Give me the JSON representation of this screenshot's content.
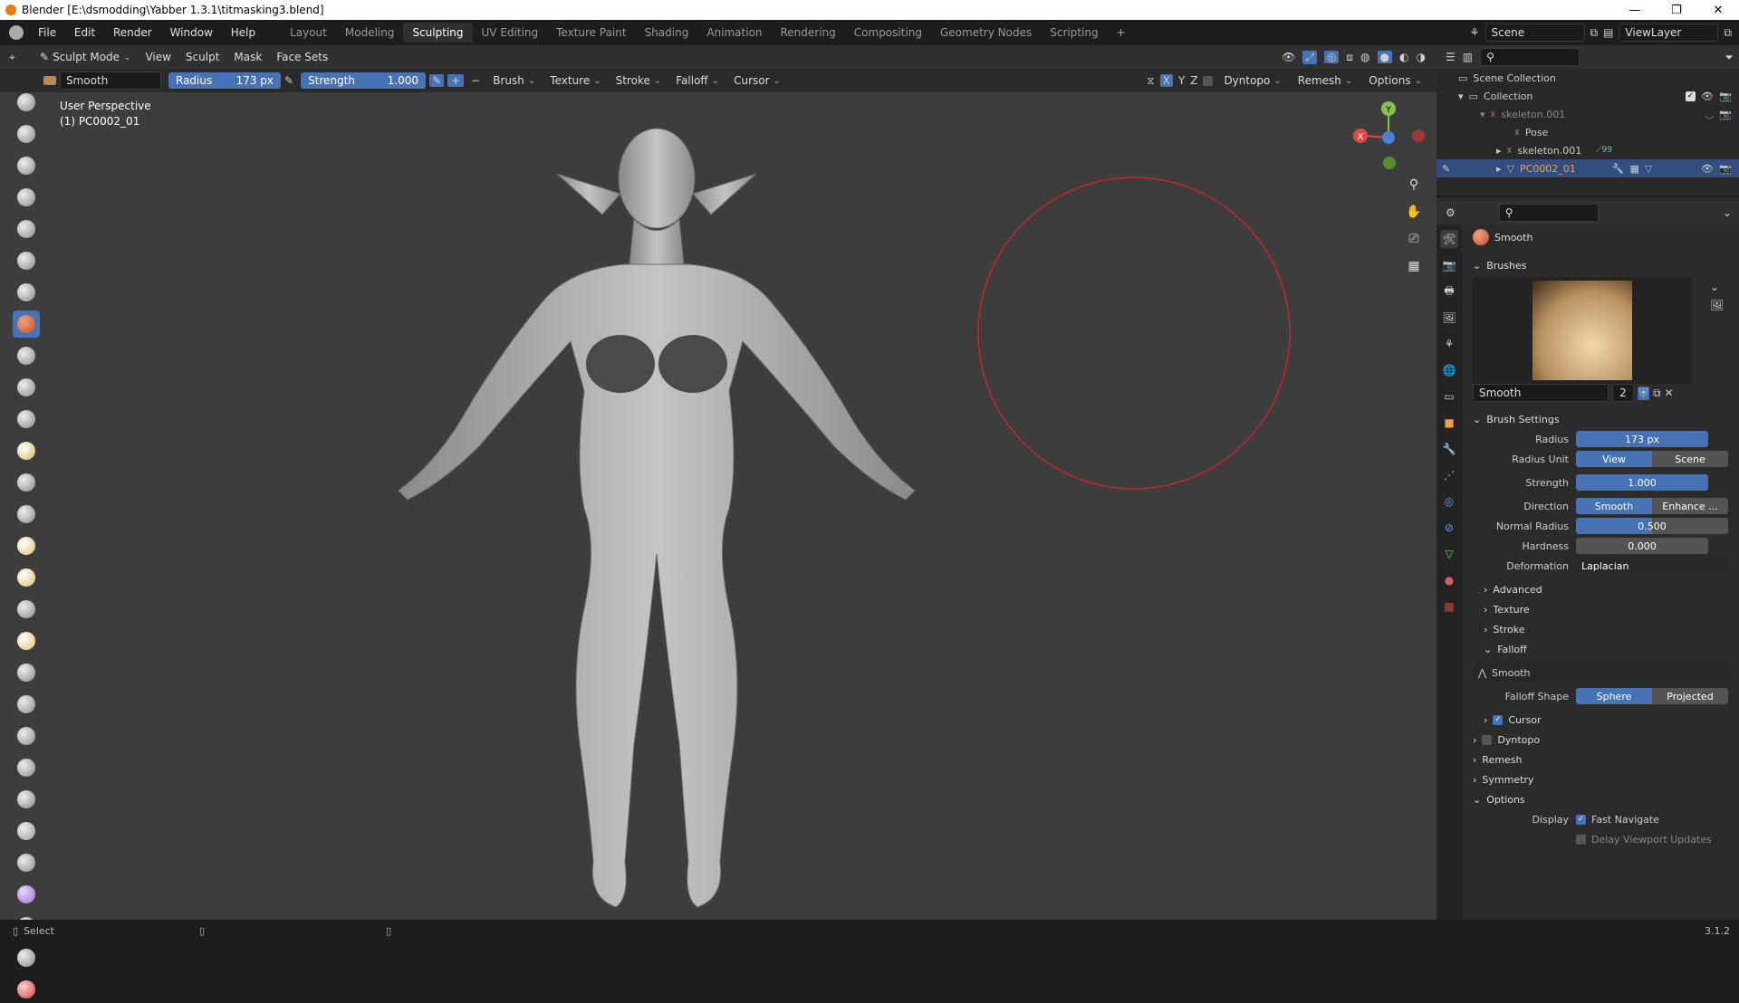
{
  "window": {
    "title": "Blender [E:\\dsmodding\\Yabber 1.3.1\\titmasking3.blend]"
  },
  "menu": [
    "File",
    "Edit",
    "Render",
    "Window",
    "Help"
  ],
  "workspaces": [
    "Layout",
    "Modeling",
    "Sculpting",
    "UV Editing",
    "Texture Paint",
    "Shading",
    "Animation",
    "Rendering",
    "Compositing",
    "Geometry Nodes",
    "Scripting"
  ],
  "active_workspace": "Sculpting",
  "scene": {
    "name": "Scene",
    "view_layer": "ViewLayer"
  },
  "viewport_header": {
    "mode": "Sculpt Mode",
    "menus": [
      "View",
      "Sculpt",
      "Mask",
      "Face Sets"
    ]
  },
  "tool_header": {
    "brush_name": "Smooth",
    "radius_label": "Radius",
    "radius_value": "173 px",
    "strength_label": "Strength",
    "strength_value": "1.000",
    "dropdowns": [
      "Brush",
      "Texture",
      "Stroke",
      "Falloff",
      "Cursor"
    ],
    "axes": [
      "X",
      "Y",
      "Z"
    ],
    "dyntopo": "Dyntopo",
    "remesh": "Remesh",
    "options": "Options"
  },
  "viewport_overlay": {
    "perspective": "User Perspective",
    "object": "(1) PC0002_01"
  },
  "gizmo": {
    "y": "Y",
    "x": "X"
  },
  "outliner": {
    "items": [
      {
        "label": "Scene Collection"
      },
      {
        "label": "Collection"
      },
      {
        "label": "skeleton.001"
      },
      {
        "label": "Pose"
      },
      {
        "label": "skeleton.001",
        "badge": "99"
      },
      {
        "label": "PC0002_01"
      }
    ]
  },
  "properties": {
    "brush_name": "Smooth",
    "brushes_title": "Brushes",
    "brush_slot": "Smooth",
    "brush_users": "2",
    "brush_settings_title": "Brush Settings",
    "radius": {
      "label": "Radius",
      "value": "173 px"
    },
    "radius_unit": {
      "label": "Radius Unit",
      "options": [
        "View",
        "Scene"
      ]
    },
    "strength": {
      "label": "Strength",
      "value": "1.000"
    },
    "direction": {
      "label": "Direction",
      "options": [
        "Smooth",
        "Enhance ..."
      ]
    },
    "normal_radius": {
      "label": "Normal Radius",
      "value": "0.500"
    },
    "hardness": {
      "label": "Hardness",
      "value": "0.000"
    },
    "deformation": {
      "label": "Deformation",
      "value": "Laplacian"
    },
    "subpanels": [
      "Advanced",
      "Texture",
      "Stroke",
      "Falloff"
    ],
    "falloff_preset": "Smooth",
    "falloff_shape": {
      "label": "Falloff Shape",
      "options": [
        "Sphere",
        "Projected"
      ]
    },
    "cursor": "Cursor",
    "dyntopo": "Dyntopo",
    "remesh": "Remesh",
    "symmetry": "Symmetry",
    "options_title": "Options",
    "display_label": "Display",
    "fast_navigate": "Fast Navigate",
    "delay_updates": "Delay Viewport Updates"
  },
  "status": {
    "select": "Select",
    "version": "3.1.2"
  }
}
